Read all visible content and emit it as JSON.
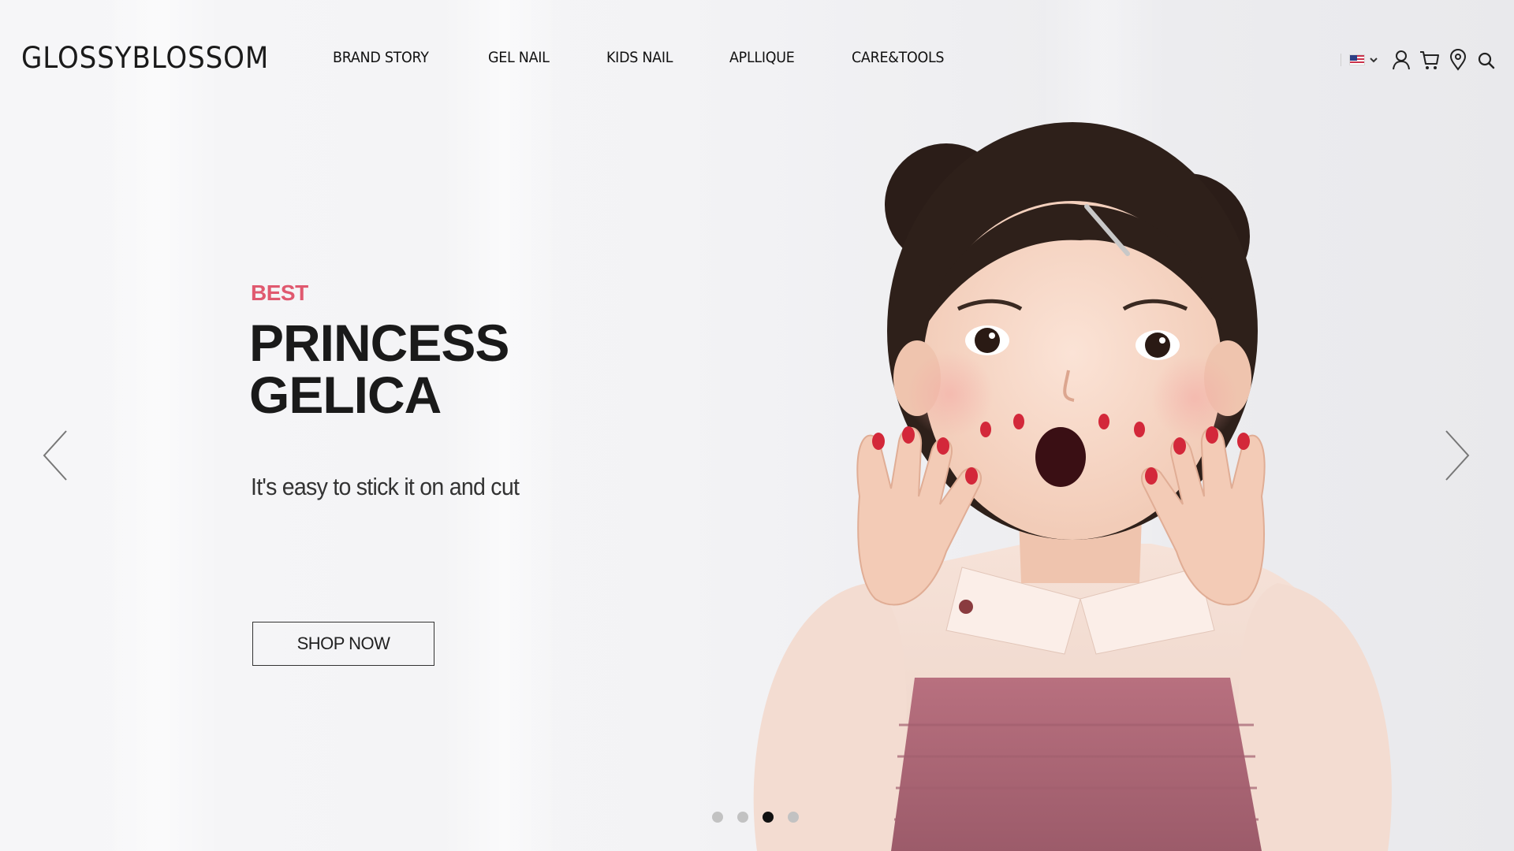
{
  "header": {
    "logo": "GLOSSYBLOSSOM",
    "nav": [
      {
        "label": "BRAND STORY"
      },
      {
        "label": "GEL NAIL"
      },
      {
        "label": "KIDS NAIL"
      },
      {
        "label": "APLLIQUE"
      },
      {
        "label": "CARE&TOOLS"
      }
    ],
    "utilities": {
      "language_flag": "us-flag-icon",
      "icons": [
        "user-icon",
        "cart-icon",
        "location-pin-icon",
        "search-icon"
      ]
    }
  },
  "hero": {
    "eyebrow": "BEST",
    "headline": [
      "PRINCESS",
      "GELICA"
    ],
    "subline": "It's easy to stick it on and cut",
    "cta_label": "SHOP NOW",
    "slides_total": 4,
    "active_slide": 3
  },
  "colors": {
    "accent": "#e0596f",
    "text": "#1a1a1a",
    "dot_active": "#111111",
    "dot_inactive": "#c2c2c2",
    "nail_polish": "#d3283a",
    "overall_pink": "#b36e7e"
  }
}
